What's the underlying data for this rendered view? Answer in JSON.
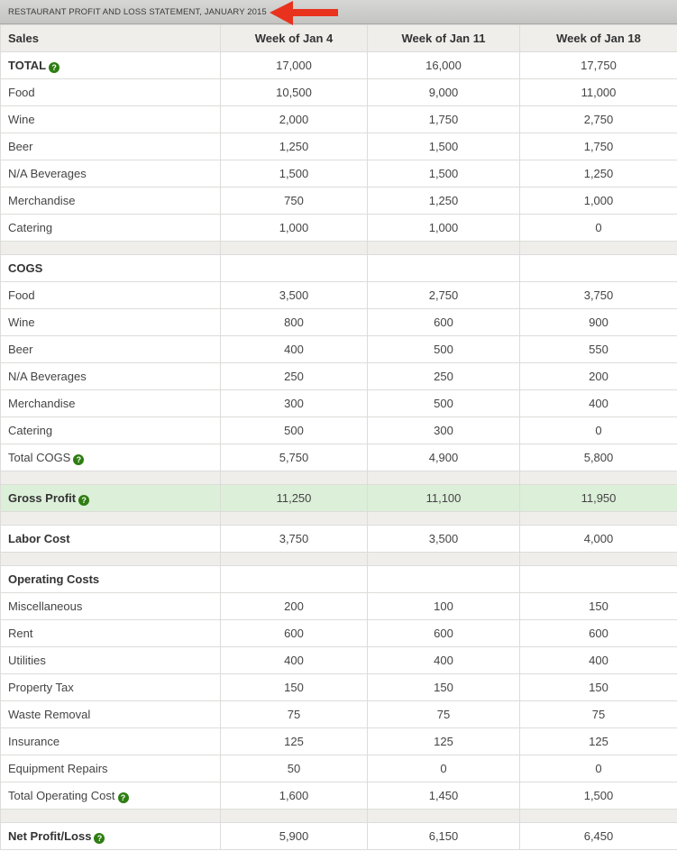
{
  "title": "RESTAURANT PROFIT AND LOSS STATEMENT, JANUARY 2015",
  "accent_color": "#e8321e",
  "help_icon_color": "#2e7d13",
  "highlight_color": "#dcefd9",
  "columns": [
    "Sales",
    "Week of Jan 4",
    "Week of Jan 11",
    "Week of Jan 18"
  ],
  "rows": [
    {
      "type": "row",
      "label": "TOTAL",
      "bold": true,
      "help": true,
      "values": [
        "17,000",
        "16,000",
        "17,750"
      ]
    },
    {
      "type": "row",
      "label": "Food",
      "values": [
        "10,500",
        "9,000",
        "11,000"
      ]
    },
    {
      "type": "row",
      "label": "Wine",
      "values": [
        "2,000",
        "1,750",
        "2,750"
      ]
    },
    {
      "type": "row",
      "label": "Beer",
      "values": [
        "1,250",
        "1,500",
        "1,750"
      ]
    },
    {
      "type": "row",
      "label": "N/A Beverages",
      "values": [
        "1,500",
        "1,500",
        "1,250"
      ]
    },
    {
      "type": "row",
      "label": "Merchandise",
      "values": [
        "750",
        "1,250",
        "1,000"
      ]
    },
    {
      "type": "row",
      "label": "Catering",
      "values": [
        "1,000",
        "1,000",
        "0"
      ]
    },
    {
      "type": "spacer"
    },
    {
      "type": "row",
      "label": "COGS",
      "bold": true,
      "values": [
        "",
        "",
        ""
      ]
    },
    {
      "type": "row",
      "label": "Food",
      "values": [
        "3,500",
        "2,750",
        "3,750"
      ]
    },
    {
      "type": "row",
      "label": "Wine",
      "values": [
        "800",
        "600",
        "900"
      ]
    },
    {
      "type": "row",
      "label": "Beer",
      "values": [
        "400",
        "500",
        "550"
      ]
    },
    {
      "type": "row",
      "label": "N/A Beverages",
      "values": [
        "250",
        "250",
        "200"
      ]
    },
    {
      "type": "row",
      "label": "Merchandise",
      "values": [
        "300",
        "500",
        "400"
      ]
    },
    {
      "type": "row",
      "label": "Catering",
      "values": [
        "500",
        "300",
        "0"
      ]
    },
    {
      "type": "row",
      "label": "Total COGS",
      "help": true,
      "values": [
        "5,750",
        "4,900",
        "5,800"
      ]
    },
    {
      "type": "spacer"
    },
    {
      "type": "row",
      "label": "Gross Profit",
      "bold": true,
      "help": true,
      "highlight": true,
      "values": [
        "11,250",
        "11,100",
        "11,950"
      ]
    },
    {
      "type": "spacer"
    },
    {
      "type": "row",
      "label": "Labor Cost",
      "bold": true,
      "values": [
        "3,750",
        "3,500",
        "4,000"
      ]
    },
    {
      "type": "spacer"
    },
    {
      "type": "row",
      "label": "Operating Costs",
      "bold": true,
      "values": [
        "",
        "",
        ""
      ]
    },
    {
      "type": "row",
      "label": "Miscellaneous",
      "values": [
        "200",
        "100",
        "150"
      ]
    },
    {
      "type": "row",
      "label": "Rent",
      "values": [
        "600",
        "600",
        "600"
      ]
    },
    {
      "type": "row",
      "label": "Utilities",
      "values": [
        "400",
        "400",
        "400"
      ]
    },
    {
      "type": "row",
      "label": "Property Tax",
      "values": [
        "150",
        "150",
        "150"
      ]
    },
    {
      "type": "row",
      "label": "Waste Removal",
      "values": [
        "75",
        "75",
        "75"
      ]
    },
    {
      "type": "row",
      "label": "Insurance",
      "values": [
        "125",
        "125",
        "125"
      ]
    },
    {
      "type": "row",
      "label": "Equipment Repairs",
      "values": [
        "50",
        "0",
        "0"
      ]
    },
    {
      "type": "row",
      "label": "Total Operating Cost",
      "help": true,
      "values": [
        "1,600",
        "1,450",
        "1,500"
      ]
    },
    {
      "type": "spacer"
    },
    {
      "type": "row",
      "label": "Net Profit/Loss",
      "bold": true,
      "help": true,
      "values": [
        "5,900",
        "6,150",
        "6,450"
      ]
    }
  ],
  "help_glyph": "?"
}
